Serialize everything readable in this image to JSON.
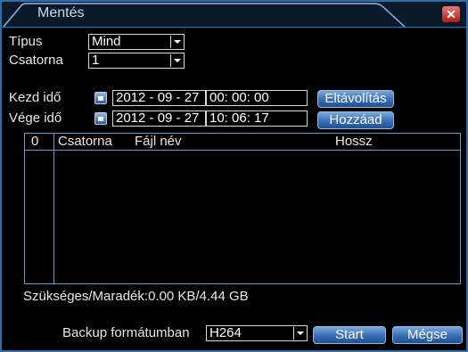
{
  "window": {
    "title": "Mentés",
    "close_label": "✕"
  },
  "form": {
    "type_label": "Típus",
    "type_value": "Mind",
    "channel_label": "Csatorna",
    "channel_value": "1",
    "start_label": "Kezd idő",
    "start_date": "2012 - 09 - 27",
    "start_time": "00: 00: 00",
    "end_label": "Vége idő",
    "end_date": "2012 - 09 - 27",
    "end_time": "10: 06: 17",
    "remove_button": "Eltávolítás",
    "add_button": "Hozzáad"
  },
  "table": {
    "columns": [
      "0",
      "Csatorna",
      "Fájl név",
      "Hossz"
    ]
  },
  "status": {
    "storage_text": "Szükséges/Maradék:0.00 KB/4.44 GB"
  },
  "footer": {
    "format_label": "Backup formátumban",
    "format_value": "H264",
    "start_button": "Start",
    "cancel_button": "Mégse"
  },
  "colors": {
    "border": "#2d6ea8",
    "button": "#3d72b8",
    "close": "#b01818"
  }
}
